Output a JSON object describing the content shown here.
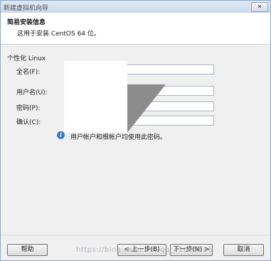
{
  "window": {
    "title": "新建虚拟机向导",
    "close_label": "✕"
  },
  "header": {
    "title": "简易安装信息",
    "subtitle": "这用于安装 CentOS 64 位。"
  },
  "section": {
    "label": "个性化 Linux"
  },
  "fields": {
    "full_name_label": "全名(F):",
    "username_label": "用户名(U):",
    "password_label": "密码(P):",
    "confirm_label": "确认(C):",
    "full_name_value": "",
    "username_value": "",
    "password_value": "",
    "confirm_value": ""
  },
  "info": {
    "icon": "info-icon",
    "text": "用户帐户和根帐户均使用此密码。"
  },
  "buttons": {
    "help": "帮助",
    "back": "< 上一步(B)",
    "next": "下一步(N) >",
    "cancel": "取消"
  },
  "watermark": {
    "text": "https://blog.csdn.net/qq_41005626"
  }
}
